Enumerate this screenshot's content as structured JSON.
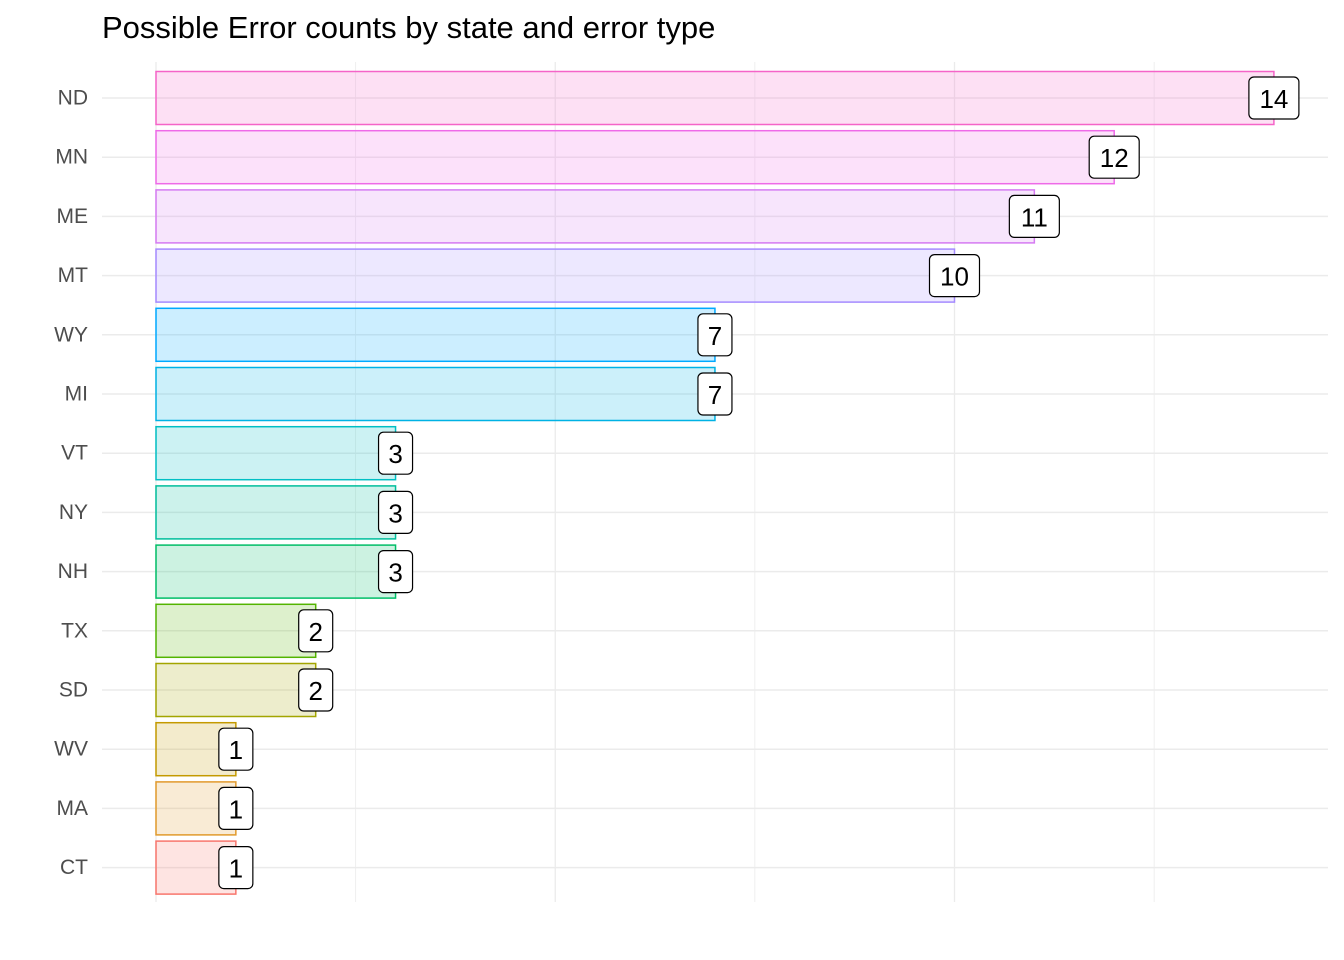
{
  "chart_data": {
    "type": "bar",
    "orientation": "horizontal",
    "title": "Possible Error counts by state and error type",
    "xlabel": "",
    "ylabel": "",
    "categories": [
      "ND",
      "MN",
      "ME",
      "MT",
      "WY",
      "MI",
      "VT",
      "NY",
      "NH",
      "TX",
      "SD",
      "WV",
      "MA",
      "CT"
    ],
    "values": [
      14,
      12,
      11,
      10,
      7,
      7,
      3,
      3,
      3,
      2,
      2,
      1,
      1,
      1
    ],
    "colors": [
      "#F564C8",
      "#EE6AE8",
      "#D57BF2",
      "#A58AFF",
      "#00A9FF",
      "#00B2E4",
      "#00BFC4",
      "#00BE9C",
      "#00BE67",
      "#53B400",
      "#A3A500",
      "#C49A00",
      "#E19A2C",
      "#F8766D"
    ],
    "fill_opacity": 0.2,
    "xlim": [
      0,
      14.5
    ],
    "x_tick_labels_shown": false,
    "grid": true,
    "legend": "none",
    "data_labels": true
  }
}
